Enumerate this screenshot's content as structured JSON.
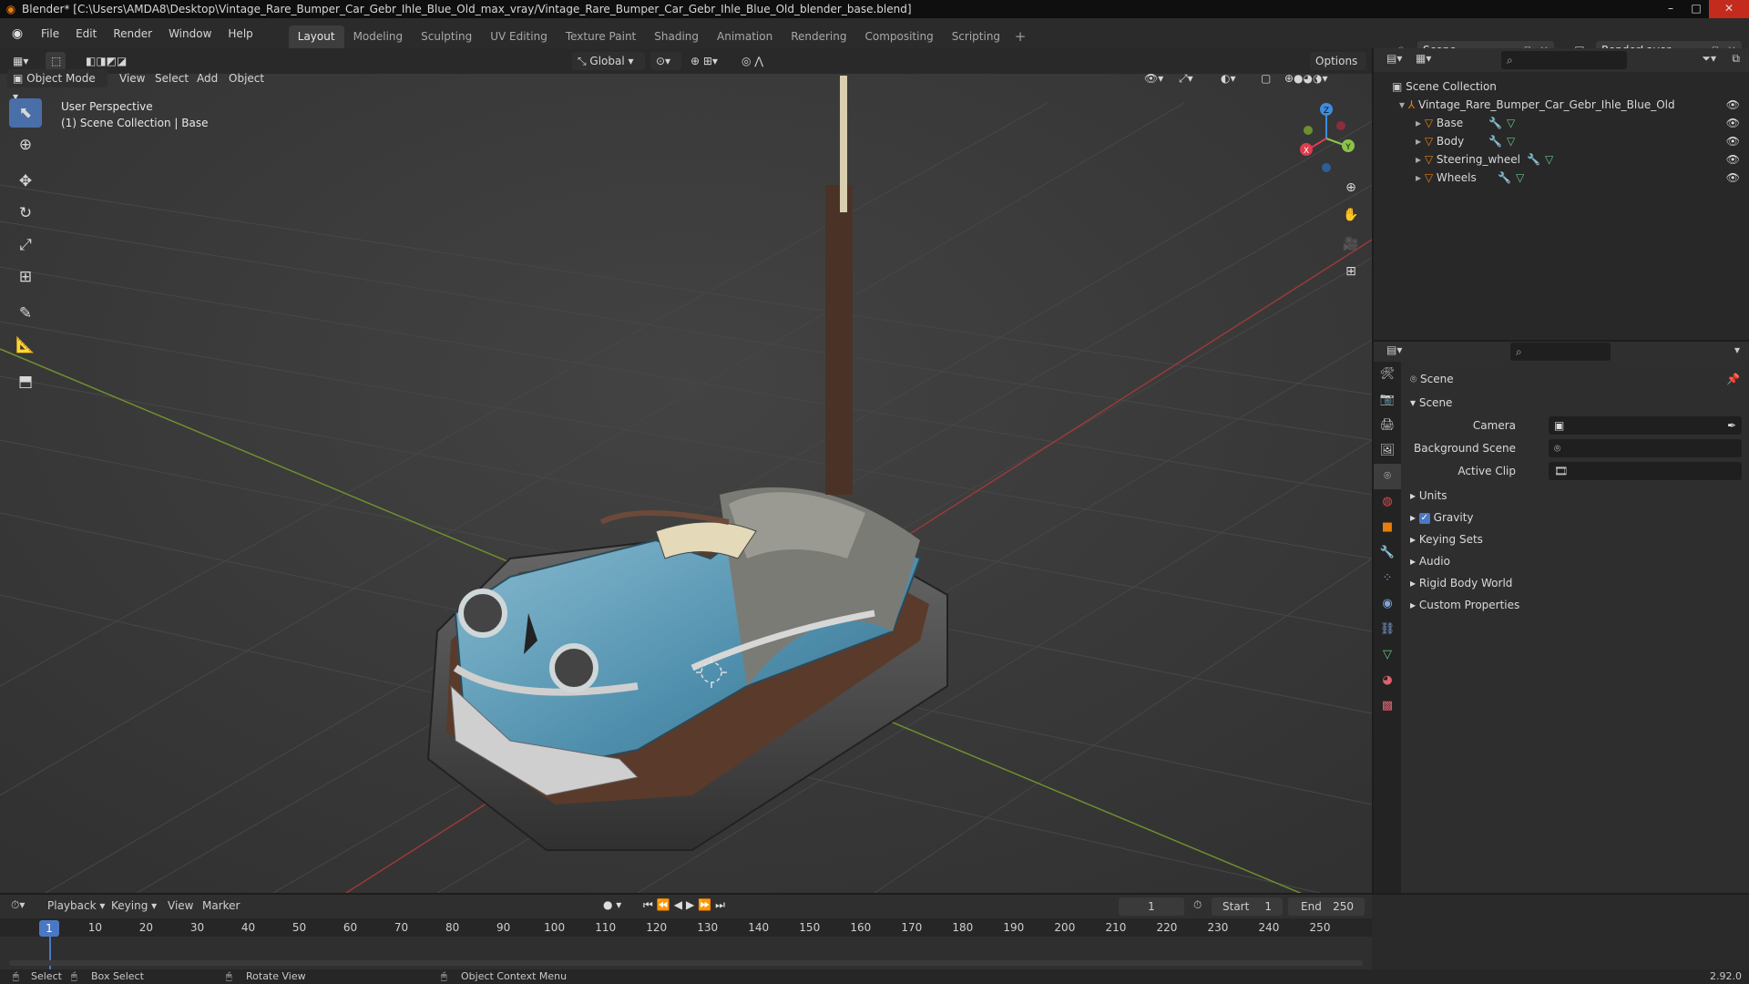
{
  "window": {
    "title": "Blender* [C:\\Users\\AMDA8\\Desktop\\Vintage_Rare_Bumper_Car_Gebr_Ihle_Blue_Old_max_vray/Vintage_Rare_Bumper_Car_Gebr_Ihle_Blue_Old_blender_base.blend]",
    "controls": {
      "minimize": "–",
      "maximize": "□",
      "close": "✕"
    }
  },
  "menubar": {
    "items": [
      "File",
      "Edit",
      "Render",
      "Window",
      "Help"
    ],
    "workspaces": [
      "Layout",
      "Modeling",
      "Sculpting",
      "UV Editing",
      "Texture Paint",
      "Shading",
      "Animation",
      "Rendering",
      "Compositing",
      "Scripting"
    ],
    "active_workspace": "Layout",
    "add_workspace": "+",
    "scene": "Scene",
    "render_layer": "RenderLayer"
  },
  "viewport": {
    "transform_orientation": "Global",
    "options_label": "Options",
    "mode": "Object Mode",
    "menu": [
      "View",
      "Select",
      "Add",
      "Object"
    ],
    "perspective_label": "User Perspective",
    "collection_label": "(1) Scene Collection | Base",
    "gizmo": {
      "x": "X",
      "y": "Y",
      "z": "Z"
    }
  },
  "outliner": {
    "root": "Scene Collection",
    "object": "Vintage_Rare_Bumper_Car_Gebr_Ihle_Blue_Old",
    "children": [
      "Base",
      "Body",
      "Steering_wheel",
      "Wheels"
    ]
  },
  "properties": {
    "context": "Scene",
    "panel": "Scene",
    "fields": {
      "camera": "Camera",
      "background_scene": "Background Scene",
      "active_clip": "Active Clip"
    },
    "sections": [
      "Units",
      "Gravity",
      "Keying Sets",
      "Audio",
      "Rigid Body World",
      "Custom Properties"
    ],
    "gravity_checked": true
  },
  "timeline": {
    "menu": [
      "Playback",
      "Keying",
      "View",
      "Marker"
    ],
    "current_frame": "1",
    "start_label": "Start",
    "start": "1",
    "end_label": "End",
    "end": "250",
    "ticks": [
      "1",
      "10",
      "20",
      "30",
      "40",
      "50",
      "60",
      "70",
      "80",
      "90",
      "100",
      "110",
      "120",
      "130",
      "140",
      "150",
      "160",
      "170",
      "180",
      "190",
      "200",
      "210",
      "220",
      "230",
      "240",
      "250"
    ]
  },
  "statusbar": {
    "select": "Select",
    "box_select": "Box Select",
    "rotate_view": "Rotate View",
    "context_menu": "Object Context Menu",
    "version": "2.92.0"
  },
  "colors": {
    "accent": "#4a78c4",
    "object_orange": "#e87d0d",
    "axis_x": "#e03c50",
    "axis_y": "#8bc34a",
    "axis_z": "#3d8ce0"
  }
}
